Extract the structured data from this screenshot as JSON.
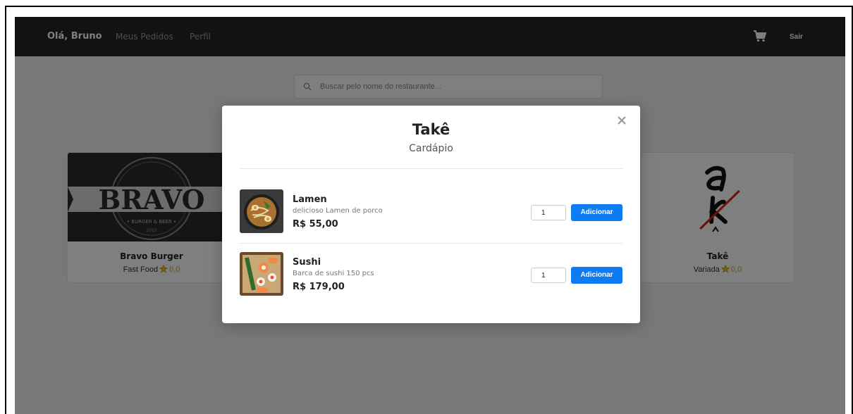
{
  "navbar": {
    "greeting": "Olá, Bruno",
    "links": [
      "Meus Pedidos",
      "Perfil"
    ],
    "cart_icon": "cart-icon",
    "logout": "Sair"
  },
  "search": {
    "placeholder": "Buscar pelo nome do restaurante...",
    "icon": "search-icon"
  },
  "restaurants": [
    {
      "name": "Bravo Burger",
      "category": "Fast Food",
      "rating": "0,0",
      "logo_text": "BRAVO",
      "logo_subtext": "• BURGER & BEER •",
      "logo_year": "2015"
    },
    {
      "name": "Takê",
      "category": "Variada",
      "rating": "0,0"
    }
  ],
  "modal": {
    "title": "Takê",
    "subtitle": "Cardápio",
    "close_icon": "close-icon",
    "items": [
      {
        "name": "Lamen",
        "description": "delicioso Lamen de porco",
        "price": "R$ 55,00",
        "quantity": "1",
        "button": "Adicionar"
      },
      {
        "name": "Sushi",
        "description": "Barca de sushi 150 pcs",
        "price": "R$ 179,00",
        "quantity": "1",
        "button": "Adicionar"
      }
    ]
  },
  "colors": {
    "navbar_bg": "#212529",
    "accent": "#0d7cf2",
    "rating_star": "#c9a227"
  }
}
